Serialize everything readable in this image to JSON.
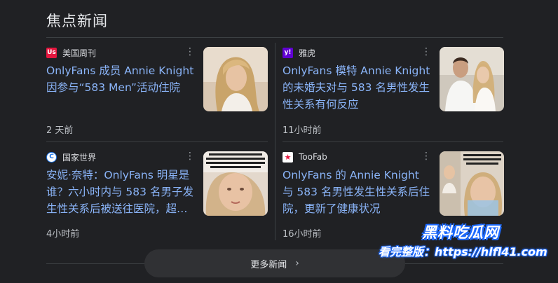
{
  "section": {
    "title": "焦点新闻"
  },
  "cards": [
    {
      "source": "美国周刊",
      "favicon_text": "Us",
      "favicon_bg": "#e5173f",
      "headline": "OnlyFans 成员 Annie Knight 因参与“583 Men”活动住院",
      "time": "2 天前"
    },
    {
      "source": "雅虎",
      "favicon_text": "y!",
      "favicon_bg": "#6001d2",
      "headline": "OnlyFans 模特 Annie Knight 的未婚夫对与 583 名男性发生性关系有何反应",
      "time": "11小时前"
    },
    {
      "source": "国家世界",
      "favicon_text": "C",
      "favicon_bg": "#1a73e8",
      "headline": "安妮·奈特：OnlyFans 明星是谁？六小时内与 583 名男子发生性关系后被送往医院，超…",
      "time": "4小时前"
    },
    {
      "source": "TooFab",
      "favicon_text": "★",
      "favicon_bg": "#ffffff",
      "headline": "OnlyFans 的 Annie Knight 与 583 名男性发生性关系后住院，更新了健康状况",
      "time": "16小时前"
    }
  ],
  "more_button": {
    "label": "更多新闻"
  },
  "watermark": {
    "line1": "黑料吃瓜网",
    "line2": "看完整版：https://hlfl41.com"
  },
  "colors": {
    "background": "#202124",
    "link": "#8ab4f8",
    "divider": "#3c4043"
  }
}
